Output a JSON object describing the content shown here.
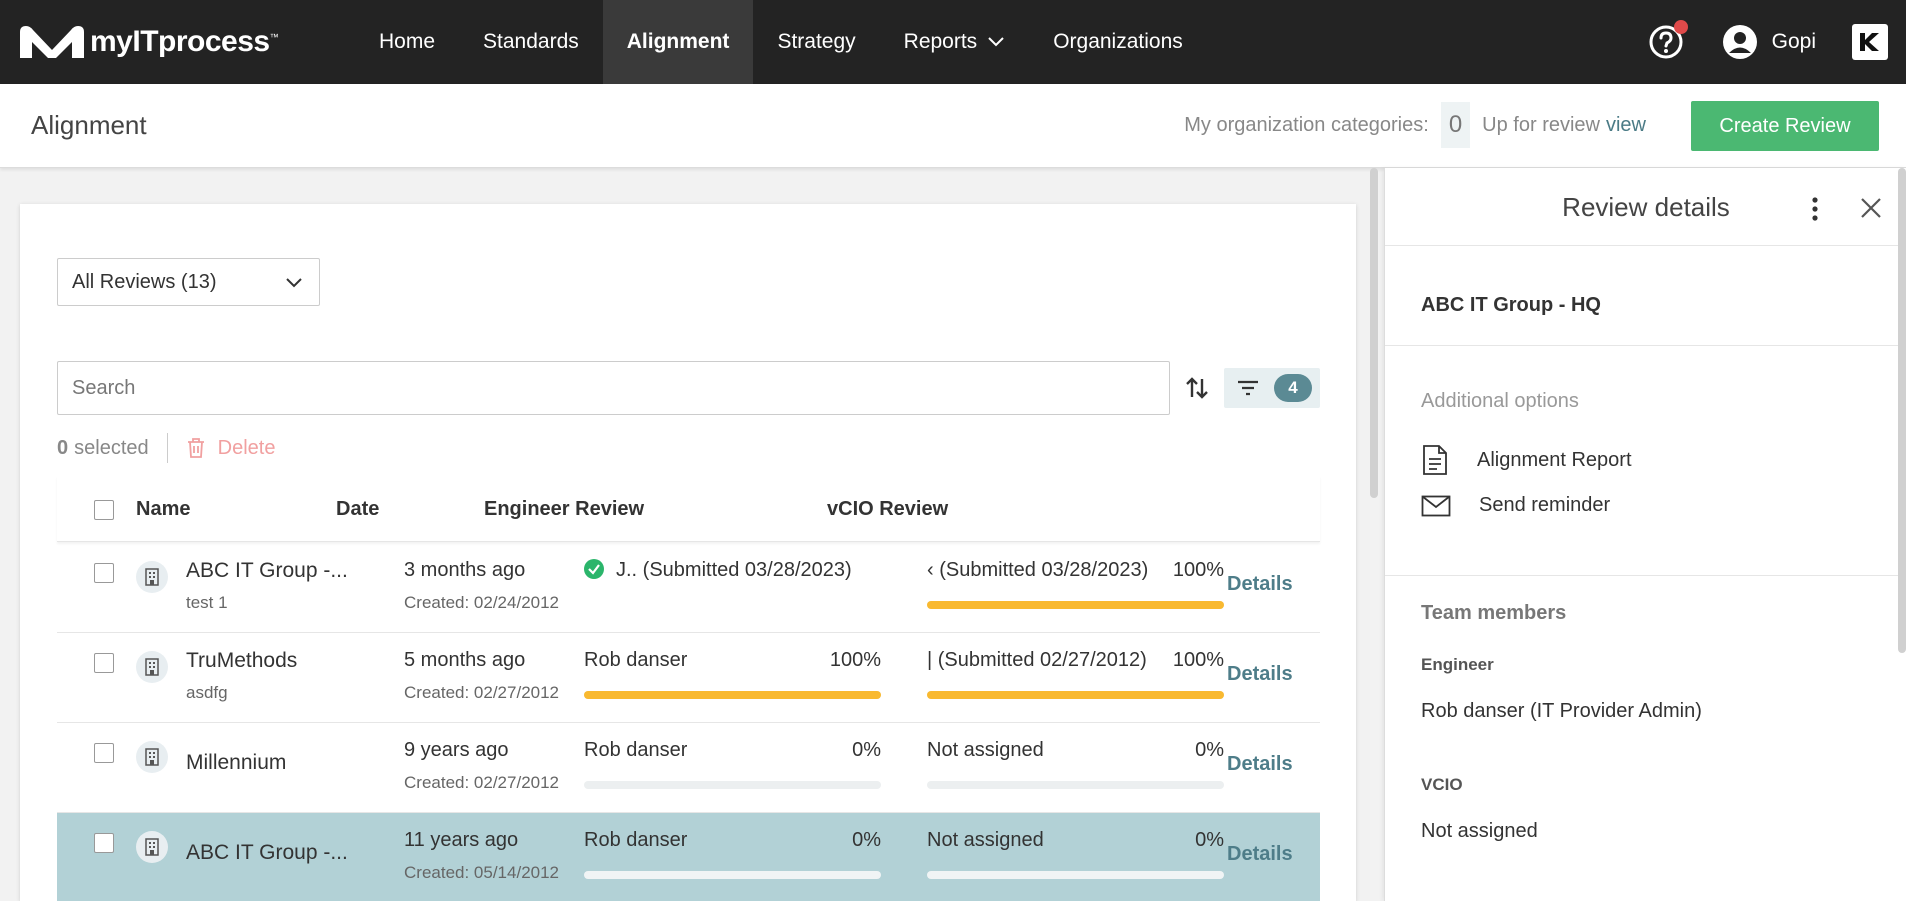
{
  "nav": {
    "logo_text": "myITprocess",
    "logo_tm": "™",
    "items": [
      {
        "label": "Home",
        "active": false
      },
      {
        "label": "Standards",
        "active": false
      },
      {
        "label": "Alignment",
        "active": true
      },
      {
        "label": "Strategy",
        "active": false
      },
      {
        "label": "Reports",
        "active": false
      },
      {
        "label": "Organizations",
        "active": false
      }
    ],
    "user_name": "Gopi"
  },
  "header": {
    "title": "Alignment",
    "org_categories_label": "My organization categories:",
    "org_categories_count": "0",
    "up_for_review_label": "Up for review",
    "view_link": "view",
    "create_button": "Create Review"
  },
  "list": {
    "filter_value": "All Reviews (13)",
    "search_placeholder": "Search",
    "filter_count": "4",
    "selected_count": "0",
    "selected_label": "selected",
    "delete_label": "Delete",
    "columns": {
      "name": "Name",
      "date": "Date",
      "engineer": "Engineer Review",
      "vcio": "vCIO Review"
    },
    "rows": [
      {
        "name": "ABC IT Group -...",
        "sub": "test 1",
        "date": "3 months ago",
        "created": "Created: 02/24/2012",
        "engineer": {
          "who": "J.. (Submitted 03/28/2023)",
          "pct": "",
          "progress": null,
          "submitted_check": true
        },
        "vcio": {
          "who": "‹ (Submitted 03/28/2023)",
          "pct": "100%",
          "progress": 1.0
        },
        "details": "Details",
        "selected": false
      },
      {
        "name": "TruMethods",
        "sub": "asdfg",
        "date": "5 months ago",
        "created": "Created: 02/27/2012",
        "engineer": {
          "who": "Rob danser",
          "pct": "100%",
          "progress": 1.0,
          "submitted_check": false
        },
        "vcio": {
          "who": "| (Submitted 02/27/2012)",
          "pct": "100%",
          "progress": 1.0
        },
        "details": "Details",
        "selected": false
      },
      {
        "name": "Millennium",
        "sub": "",
        "date": "9 years ago",
        "created": "Created: 02/27/2012",
        "engineer": {
          "who": "Rob danser",
          "pct": "0%",
          "progress": 0,
          "submitted_check": false
        },
        "vcio": {
          "who": "Not assigned",
          "pct": "0%",
          "progress": 0
        },
        "details": "Details",
        "selected": false
      },
      {
        "name": "ABC IT Group -...",
        "sub": "",
        "date": "11 years ago",
        "created": "Created: 05/14/2012",
        "engineer": {
          "who": "Rob danser",
          "pct": "0%",
          "progress": 0,
          "submitted_check": false
        },
        "vcio": {
          "who": "Not assigned",
          "pct": "0%",
          "progress": 0
        },
        "details": "Details",
        "selected": true
      }
    ]
  },
  "panel": {
    "title": "Review details",
    "org_name": "ABC IT Group - HQ",
    "additional_options_label": "Additional options",
    "options": [
      {
        "label": "Alignment Report",
        "icon": "document-icon"
      },
      {
        "label": "Send reminder",
        "icon": "envelope-icon"
      }
    ],
    "team_label": "Team members",
    "engineer_label": "Engineer",
    "engineer_name": "Rob danser (IT Provider Admin)",
    "vcio_label": "VCIO",
    "vcio_name": "Not assigned"
  },
  "colors": {
    "nav_bg": "#232323",
    "accent_green": "#4bb872",
    "progress_yellow": "#f9b930",
    "selected_row": "#b2d1d6",
    "link_teal": "#4e7d89",
    "notification_red": "#e04a4a"
  }
}
